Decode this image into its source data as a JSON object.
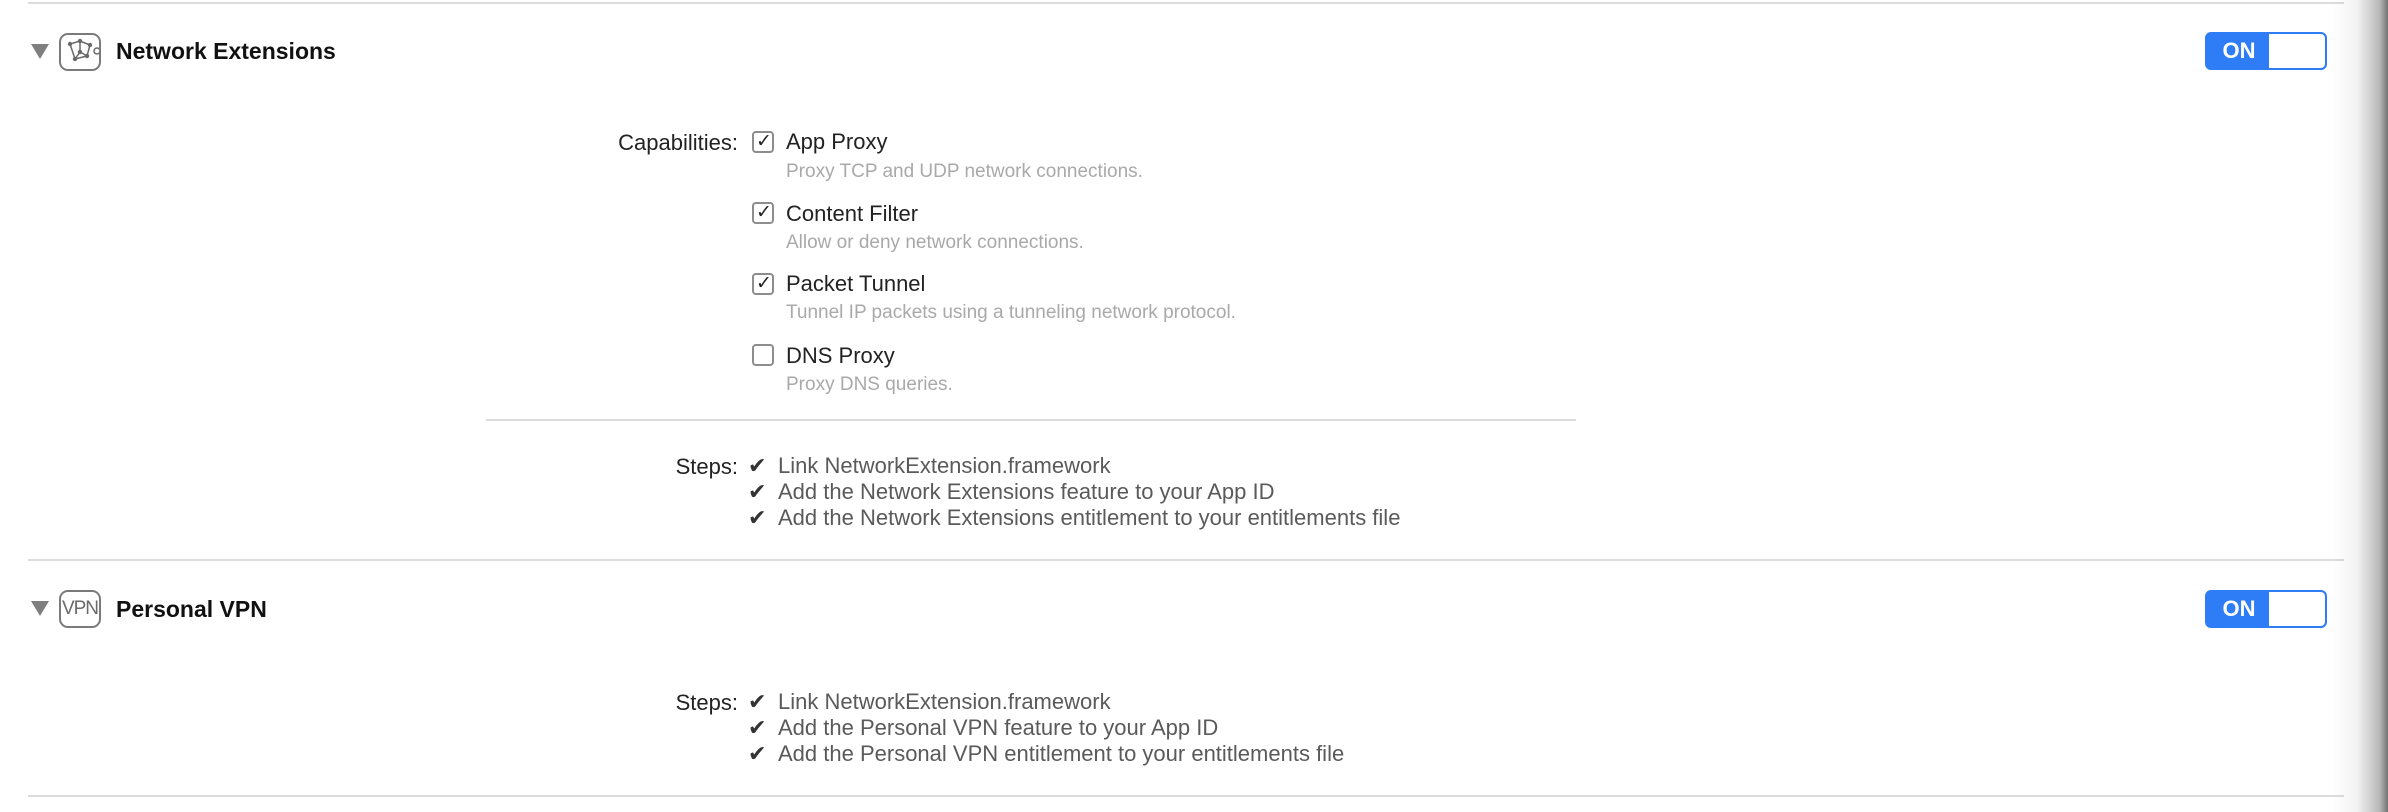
{
  "sections": [
    {
      "title": "Network Extensions",
      "icon": "network-extensions-icon",
      "toggle": "ON",
      "capabilities_label": "Capabilities:",
      "capabilities": [
        {
          "label": "App Proxy",
          "description": "Proxy TCP and UDP network connections.",
          "checked": true
        },
        {
          "label": "Content Filter",
          "description": "Allow or deny network connections.",
          "checked": true
        },
        {
          "label": "Packet Tunnel",
          "description": "Tunnel IP packets using a tunneling network protocol.",
          "checked": true
        },
        {
          "label": "DNS Proxy",
          "description": "Proxy DNS queries.",
          "checked": false
        }
      ],
      "steps_label": "Steps:",
      "steps": [
        "Link NetworkExtension.framework",
        "Add the Network Extensions feature to your App ID",
        "Add the Network Extensions entitlement to your entitlements file"
      ]
    },
    {
      "title": "Personal VPN",
      "icon": "vpn-icon",
      "icon_text": "VPN",
      "toggle": "ON",
      "steps_label": "Steps:",
      "steps": [
        "Link NetworkExtension.framework",
        "Add the Personal VPN feature to your App ID",
        "Add the Personal VPN entitlement to your entitlements file"
      ]
    }
  ],
  "glyphs": {
    "checkmark": "✓",
    "step_check": "✔"
  },
  "colors": {
    "accent": "#2f7df6",
    "description_text": "#a9a9a9",
    "divider": "#dcdcdc"
  }
}
